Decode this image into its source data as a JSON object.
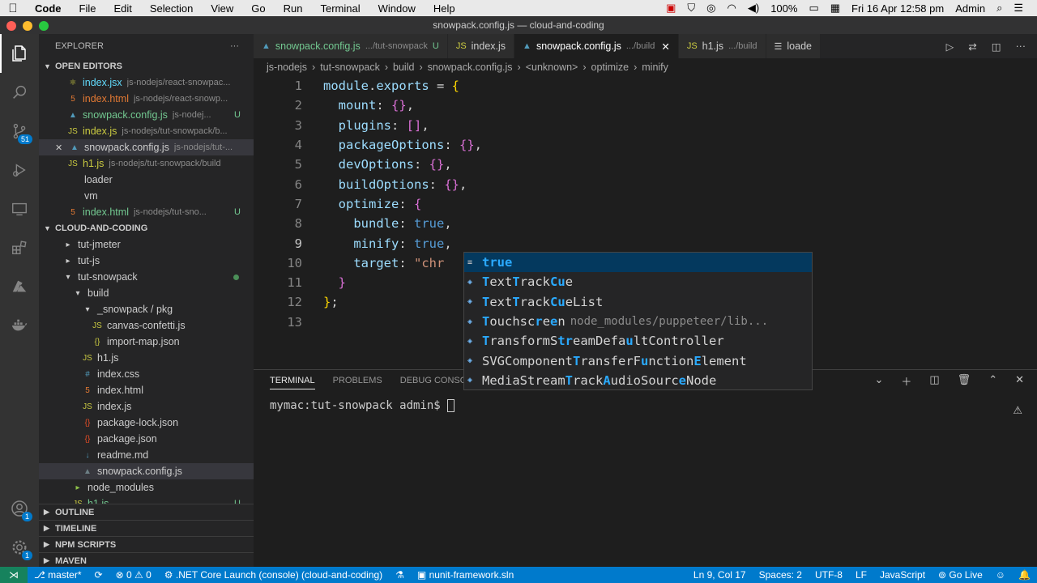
{
  "mac_menu": {
    "app_name": "Code",
    "items": [
      "File",
      "Edit",
      "Selection",
      "View",
      "Go",
      "Run",
      "Terminal",
      "Window",
      "Help"
    ],
    "battery": "100%",
    "datetime": "Fri 16 Apr  12:58 pm",
    "user": "Admin"
  },
  "window_title": "snowpack.config.js — cloud-and-coding",
  "activity_bar": {
    "scm_badge": "51",
    "account_badge": "1",
    "settings_badge": "1"
  },
  "sidebar": {
    "title": "EXPLORER",
    "more": "···",
    "open_editors": {
      "label": "OPEN EDITORS",
      "items": [
        {
          "name": "index.jsx",
          "desc": "js-nodejs/react-snowpac...",
          "icon": "jsx-icon",
          "color": "#61dafb"
        },
        {
          "name": "index.html",
          "desc": "js-nodejs/react-snowp...",
          "icon": "html-icon",
          "color": "#e37933"
        },
        {
          "name": "snowpack.config.js",
          "desc": "js-nodej...",
          "icon": "snowpack-icon",
          "color": "#73c991",
          "status": "U"
        },
        {
          "name": "index.js",
          "desc": "js-nodejs/tut-snowpack/b...",
          "icon": "js-icon",
          "color": "#cbcb41"
        },
        {
          "name": "snowpack.config.js",
          "desc": "js-nodejs/tut-...",
          "icon": "snowpack-icon",
          "color": "#cccccc",
          "close": "✕"
        },
        {
          "name": "h1.js",
          "desc": "js-nodejs/tut-snowpack/build",
          "icon": "js-icon",
          "color": "#cbcb41"
        },
        {
          "name": "loader",
          "desc": "",
          "icon": "",
          "color": "#cccccc"
        },
        {
          "name": "vm",
          "desc": "",
          "icon": "",
          "color": "#cccccc"
        },
        {
          "name": "index.html",
          "desc": "js-nodejs/tut-sno...",
          "icon": "html-icon",
          "color": "#73c991",
          "status": "U"
        }
      ]
    },
    "project": {
      "label": "CLOUD-AND-CODING",
      "tree": [
        {
          "name": "tut-jmeter",
          "indent": 1,
          "type": "folder-closed"
        },
        {
          "name": "tut-js",
          "indent": 1,
          "type": "folder-closed"
        },
        {
          "name": "tut-snowpack",
          "indent": 1,
          "type": "folder-open",
          "dot": true
        },
        {
          "name": "build",
          "indent": 2,
          "type": "folder-open"
        },
        {
          "name": "_snowpack / pkg",
          "indent": 3,
          "type": "folder-open"
        },
        {
          "name": "canvas-confetti.js",
          "indent": 4,
          "type": "js"
        },
        {
          "name": "import-map.json",
          "indent": 4,
          "type": "json"
        },
        {
          "name": "h1.js",
          "indent": 3,
          "type": "js"
        },
        {
          "name": "index.css",
          "indent": 3,
          "type": "css"
        },
        {
          "name": "index.html",
          "indent": 3,
          "type": "html"
        },
        {
          "name": "index.js",
          "indent": 3,
          "type": "js"
        },
        {
          "name": "package-lock.json",
          "indent": 3,
          "type": "json-red"
        },
        {
          "name": "package.json",
          "indent": 3,
          "type": "json-red"
        },
        {
          "name": "readme.md",
          "indent": 3,
          "type": "md"
        },
        {
          "name": "snowpack.config.js",
          "indent": 3,
          "type": "snowpack",
          "selected": true
        },
        {
          "name": "node_modules",
          "indent": 2,
          "type": "folder-node"
        },
        {
          "name": "h1.js",
          "indent": 2,
          "type": "js-green",
          "status": "U"
        }
      ]
    },
    "bottom_sections": [
      "OUTLINE",
      "TIMELINE",
      "NPM SCRIPTS",
      "MAVEN"
    ]
  },
  "tabs": [
    {
      "name": "snowpack.config.js",
      "desc": ".../tut-snowpack",
      "status": "U",
      "icon": "snowpack-icon",
      "color": "#73c991",
      "active": false
    },
    {
      "name": "index.js",
      "desc": "",
      "status": "",
      "icon": "js-icon",
      "color": "#cccccc",
      "active": false
    },
    {
      "name": "snowpack.config.js",
      "desc": ".../build",
      "status": "",
      "icon": "snowpack-icon",
      "color": "#ffffff",
      "active": true,
      "close": "✕"
    },
    {
      "name": "h1.js",
      "desc": ".../build",
      "status": "",
      "icon": "js-icon",
      "color": "#cccccc",
      "active": false
    },
    {
      "name": "loade",
      "desc": "",
      "status": "",
      "icon": "file-icon",
      "color": "#cccccc",
      "active": false
    }
  ],
  "breadcrumb": [
    "js-nodejs",
    "›",
    "tut-snowpack",
    "›",
    "build",
    "›",
    "snowpack.config.js",
    "›",
    "<unknown>",
    "›",
    "optimize",
    "›",
    "minify"
  ],
  "code_lines": [
    {
      "n": "1",
      "parts": [
        [
          "k",
          "module"
        ],
        [
          "t",
          "."
        ],
        [
          "k",
          "exports"
        ],
        [
          "t",
          " = "
        ],
        [
          "br",
          "{"
        ]
      ]
    },
    {
      "n": "2",
      "parts": [
        [
          "t",
          "  "
        ],
        [
          "k",
          "mount"
        ],
        [
          "t",
          ": "
        ],
        [
          "br2",
          "{}"
        ],
        [
          "t",
          ","
        ]
      ]
    },
    {
      "n": "3",
      "parts": [
        [
          "t",
          "  "
        ],
        [
          "k",
          "plugins"
        ],
        [
          "t",
          ": "
        ],
        [
          "br2",
          "[]"
        ],
        [
          "t",
          ","
        ]
      ]
    },
    {
      "n": "4",
      "parts": [
        [
          "t",
          "  "
        ],
        [
          "k",
          "packageOptions"
        ],
        [
          "t",
          ": "
        ],
        [
          "br2",
          "{}"
        ],
        [
          "t",
          ","
        ]
      ]
    },
    {
      "n": "5",
      "parts": [
        [
          "t",
          "  "
        ],
        [
          "k",
          "devOptions"
        ],
        [
          "t",
          ": "
        ],
        [
          "br2",
          "{}"
        ],
        [
          "t",
          ","
        ]
      ]
    },
    {
      "n": "6",
      "parts": [
        [
          "t",
          "  "
        ],
        [
          "k",
          "buildOptions"
        ],
        [
          "t",
          ": "
        ],
        [
          "br2",
          "{}"
        ],
        [
          "t",
          ","
        ]
      ]
    },
    {
      "n": "7",
      "parts": [
        [
          "t",
          "  "
        ],
        [
          "k",
          "optimize"
        ],
        [
          "t",
          ": "
        ],
        [
          "br2",
          "{"
        ]
      ]
    },
    {
      "n": "8",
      "parts": [
        [
          "t",
          "    "
        ],
        [
          "k",
          "bundle"
        ],
        [
          "t",
          ": "
        ],
        [
          "b",
          "true"
        ],
        [
          "t",
          ","
        ]
      ]
    },
    {
      "n": "9",
      "parts": [
        [
          "t",
          "    "
        ],
        [
          "k",
          "minify"
        ],
        [
          "t",
          ": "
        ],
        [
          "b",
          "true"
        ],
        [
          "t",
          ","
        ]
      ],
      "current": true
    },
    {
      "n": "10",
      "parts": [
        [
          "t",
          "    "
        ],
        [
          "k",
          "target"
        ],
        [
          "t",
          ": "
        ],
        [
          "s",
          "\"chr"
        ]
      ]
    },
    {
      "n": "11",
      "parts": [
        [
          "t",
          "  "
        ],
        [
          "br2",
          "}"
        ]
      ]
    },
    {
      "n": "12",
      "parts": [
        [
          "br",
          "}"
        ],
        [
          "t",
          ";"
        ]
      ]
    },
    {
      "n": "13",
      "parts": []
    }
  ],
  "suggestions": [
    {
      "icon": "keyword-icon",
      "parts": [
        [
          "m",
          "true"
        ]
      ],
      "desc": "",
      "selected": true
    },
    {
      "icon": "class-icon",
      "parts": [
        [
          "m",
          "T"
        ],
        [
          "t",
          "ext"
        ],
        [
          "m",
          "T"
        ],
        [
          "t",
          "rack"
        ],
        [
          "m",
          "Cu"
        ],
        [
          "t",
          "e"
        ]
      ],
      "desc": ""
    },
    {
      "icon": "class-icon",
      "parts": [
        [
          "m",
          "T"
        ],
        [
          "t",
          "ext"
        ],
        [
          "m",
          "T"
        ],
        [
          "t",
          "rack"
        ],
        [
          "m",
          "Cu"
        ],
        [
          "t",
          "eList"
        ]
      ],
      "desc": ""
    },
    {
      "icon": "interface-icon",
      "parts": [
        [
          "m",
          "T"
        ],
        [
          "t",
          "ouchsc"
        ],
        [
          "m",
          "r"
        ],
        [
          "t",
          "e"
        ],
        [
          "m",
          "e"
        ],
        [
          "t",
          "n"
        ]
      ],
      "desc": "node_modules/puppeteer/lib..."
    },
    {
      "icon": "class-icon",
      "parts": [
        [
          "m",
          "T"
        ],
        [
          "t",
          "ransformS"
        ],
        [
          "m",
          "tr"
        ],
        [
          "t",
          "eamDefa"
        ],
        [
          "m",
          "u"
        ],
        [
          "t",
          "ltController"
        ]
      ],
      "desc": ""
    },
    {
      "icon": "class-icon",
      "parts": [
        [
          "t",
          "SVGComponent"
        ],
        [
          "m",
          "T"
        ],
        [
          "t",
          "ransferF"
        ],
        [
          "m",
          "u"
        ],
        [
          "t",
          "nction"
        ],
        [
          "m",
          "E"
        ],
        [
          "t",
          "lement"
        ]
      ],
      "desc": ""
    },
    {
      "icon": "class-icon",
      "parts": [
        [
          "t",
          "MediaStream"
        ],
        [
          "m",
          "T"
        ],
        [
          "t",
          "rack"
        ],
        [
          "m",
          "A"
        ],
        [
          "t",
          "udioSourc"
        ],
        [
          "m",
          "e"
        ],
        [
          "t",
          "Node"
        ]
      ],
      "desc": ""
    }
  ],
  "panel": {
    "tabs": [
      "TERMINAL",
      "PROBLEMS",
      "DEBUG CONSOLE"
    ],
    "terminal_prompt": "mymac:tut-snowpack admin$ "
  },
  "statusbar": {
    "branch": "master*",
    "errors": "0",
    "warnings": "0",
    "launch": ".NET Core Launch (console) (cloud-and-coding)",
    "solution": "nunit-framework.sln",
    "position": "Ln 9, Col 17",
    "spaces": "Spaces: 2",
    "encoding": "UTF-8",
    "eol": "LF",
    "language": "JavaScript",
    "golive": "Go Live"
  },
  "colors": {
    "accent": "#007acc",
    "activity_bar": "#333333",
    "sidebar": "#252526",
    "editor": "#1e1e1e"
  }
}
